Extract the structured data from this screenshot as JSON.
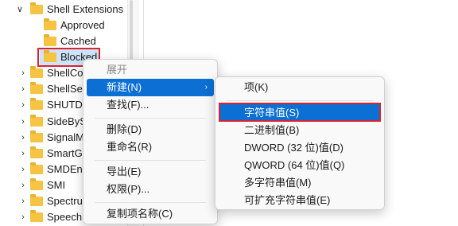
{
  "tree": {
    "items": [
      {
        "label": "Shell Extensions",
        "expanded": true,
        "indent": 0
      },
      {
        "label": "Approved",
        "expanded": null,
        "indent": 1
      },
      {
        "label": "Cached",
        "expanded": null,
        "indent": 1
      },
      {
        "label": "Blocked",
        "expanded": null,
        "indent": 1,
        "selected": true
      },
      {
        "label": "ShellCo",
        "expanded": false,
        "indent": 0
      },
      {
        "label": "ShellSer",
        "expanded": false,
        "indent": 0
      },
      {
        "label": "SHUTD",
        "expanded": false,
        "indent": 0
      },
      {
        "label": "SideByS",
        "expanded": false,
        "indent": 0
      },
      {
        "label": "SignalM",
        "expanded": false,
        "indent": 0
      },
      {
        "label": "SmartG",
        "expanded": false,
        "indent": 0
      },
      {
        "label": "SMDEn",
        "expanded": false,
        "indent": 0
      },
      {
        "label": "SMI",
        "expanded": false,
        "indent": 0
      },
      {
        "label": "Spectru",
        "expanded": false,
        "indent": 0
      },
      {
        "label": "Speech",
        "expanded": false,
        "indent": 0
      }
    ]
  },
  "context_menu": {
    "items": [
      {
        "label": "展开",
        "disabled": true
      },
      {
        "label": "新建(N)",
        "active": true,
        "submenu": true
      },
      {
        "label": "查找(F)..."
      },
      {
        "label": "删除(D)"
      },
      {
        "label": "重命名(R)"
      },
      {
        "label": "导出(E)"
      },
      {
        "label": "权限(P)..."
      },
      {
        "label": "复制项名称(C)"
      }
    ],
    "arrow": "›"
  },
  "submenu": {
    "items": [
      {
        "label": "项(K)"
      },
      {
        "label": "字符串值(S)",
        "active": true
      },
      {
        "label": "二进制值(B)"
      },
      {
        "label": "DWORD (32 位)值(D)"
      },
      {
        "label": "QWORD (64 位)值(Q)"
      },
      {
        "label": "多字符串值(M)"
      },
      {
        "label": "可扩充字符串值(E)"
      }
    ]
  },
  "icons": {
    "chevron_down": "∨",
    "chevron_right": "›",
    "folder": "folder-icon"
  },
  "colors": {
    "accent": "#0b6fd3",
    "highlight": "#d9232e",
    "folder": "#f6c343",
    "selection": "#cde3f8"
  }
}
